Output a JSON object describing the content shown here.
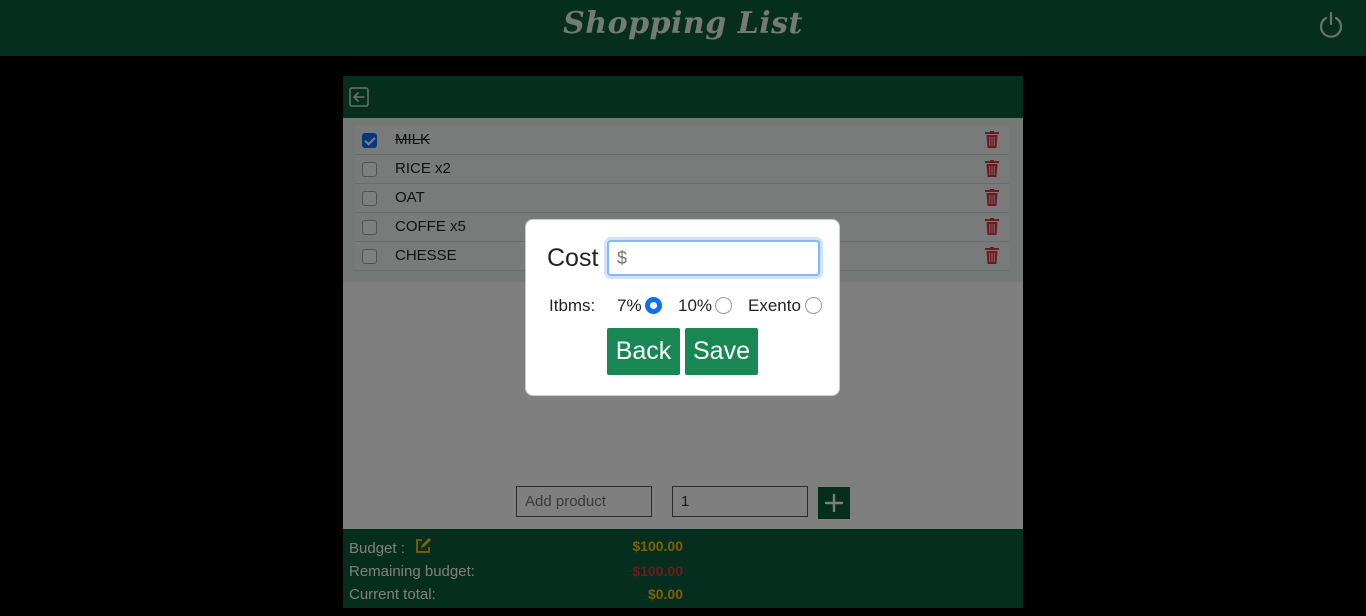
{
  "app": {
    "title": "Shopping List"
  },
  "list": {
    "items": [
      {
        "label": "MILK",
        "checked": true
      },
      {
        "label": "RICE x2",
        "checked": false
      },
      {
        "label": "OAT",
        "checked": false
      },
      {
        "label": "COFFE x5",
        "checked": false
      },
      {
        "label": "CHESSE",
        "checked": false
      }
    ]
  },
  "add": {
    "product_placeholder": "Add product",
    "quantity_value": "1"
  },
  "footer": {
    "budget_label": "Budget :",
    "budget_value": "$100.00",
    "remaining_label": "Remaining budget:",
    "remaining_value": "$100.00",
    "total_label": "Current total:",
    "total_value": "$0.00"
  },
  "modal": {
    "cost_label": "Cost",
    "cost_placeholder": "$",
    "itbms_label": "Itbms:",
    "options": [
      "7%",
      "10%",
      "Exento"
    ],
    "selected_option": "7%",
    "back_label": "Back",
    "save_label": "Save"
  },
  "colors": {
    "brand": "#0b5c3d",
    "accent_button": "#198754",
    "radio_selected": "#0d6efd",
    "budget_value": "#ffc107",
    "remaining_value": "#dc3545",
    "trash": "#dc3545"
  },
  "icons": [
    "power-icon",
    "back-arrow-icon",
    "trash-icon",
    "plus-icon",
    "edit-icon"
  ]
}
